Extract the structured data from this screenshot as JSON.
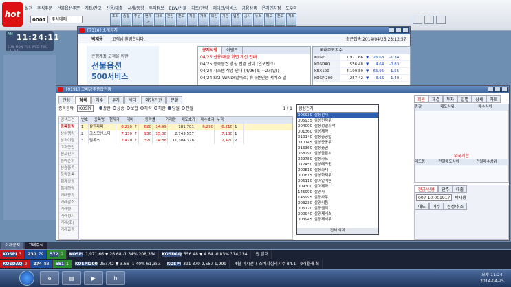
{
  "topbar": {
    "logo": "hot",
    "menu": [
      "실천",
      "주식주문",
      "선물옵션주문",
      "계좌/잔고",
      "신용/대출",
      "시세/동향",
      "투자정보",
      "ELW/선물",
      "차트/전략",
      "재테크/서비스",
      "금융상품",
      "온라인지점",
      "도우미"
    ],
    "account": "0001",
    "account_select": "주식매매",
    "toolbar": [
      "조회",
      "종합",
      "주문",
      "현재가",
      "차트",
      "관심",
      "잔고",
      "체결",
      "거래",
      "외인",
      "기관",
      "업종",
      "공시",
      "뉴스",
      "메모",
      "잔고",
      "계좌"
    ]
  },
  "clock": {
    "ampm": "AM",
    "time": "11:24:11",
    "days": "SUN MON TUE WED THU FRI SAT"
  },
  "win1": {
    "title": "[7310] 소개공지",
    "user": "박재용",
    "greeting": "고객님 환영합니다.",
    "last_login": "최근접속:2014/04/25 23:12:57",
    "ad": {
      "line1": "은행계좌 고객을 위한",
      "line2": "선물옵션",
      "line3": "500서비스"
    },
    "notice_tabs": [
      "공지사항",
      "이벤트"
    ],
    "notices": [
      "04/25 신용/대출 화면 개선 안내",
      "04/25 증목증권 명칭 변경 안내 (인포밴크)",
      "04/24 시스템 작업 안내 (4/26(토)~27(일))",
      "04/24 SKT WIND(말뚝조) 휴대폰인증 서비스 일"
    ],
    "index_title": "국내주요지수",
    "indices": [
      {
        "name": "KOSPI",
        "value": "1,971.66",
        "dir": "▼",
        "chg": "26.68",
        "pct": "-1.34"
      },
      {
        "name": "KOSDAQ",
        "value": "556.48",
        "dir": "▼",
        "chg": "4.64",
        "pct": "-0.83"
      },
      {
        "name": "KRX100",
        "value": "4,199.80",
        "dir": "▼",
        "chg": "65.95",
        "pct": "-1.55"
      },
      {
        "name": "KOSPI200",
        "value": "257.42",
        "dir": "▼",
        "chg": "3.66",
        "pct": "-1.40"
      }
    ]
  },
  "win2": {
    "title": "[0191] 고배당주종합현황",
    "tabs": [
      "관심",
      "검색",
      "지수",
      "투자",
      "섹터",
      "외인/기관",
      "분할"
    ],
    "filter": {
      "label": "종목등락",
      "market": "KOSPI",
      "opts": [
        "상한",
        "상승",
        "보합",
        "하락",
        "하한",
        "당일",
        "전일"
      ],
      "page": "1 / 1"
    },
    "conditions": [
      "검색조건",
      "종목등락",
      "상위랭킹",
      "상위이탈",
      "고저근접",
      "신고신저",
      "등락순위",
      "상승종목",
      "하락종목",
      "회계상승",
      "회계하락",
      "거래증가",
      "거래감소",
      "거래량",
      "거래정지",
      "거래(조)",
      "거래급등"
    ],
    "headers": [
      "번호",
      "종목명",
      "현재가",
      "대비",
      "등락률",
      "거래량",
      "매도호가",
      "매수호가",
      "누적"
    ],
    "rows": [
      {
        "no": "1",
        "name": "삼한파피",
        "price": "6,290",
        "dir": "↑",
        "chg": "820",
        "pct": "14.99",
        "vol": "181,701",
        "ask": "6,290",
        "bid": "6,210",
        "n": "1"
      },
      {
        "no": "2",
        "name": "코스모신소재",
        "price": "7,130",
        "dir": "↑",
        "chg": "930",
        "pct": "15.00",
        "vol": "2,743,557",
        "ask": "",
        "bid": "7,130",
        "n": "1"
      },
      {
        "no": "3",
        "name": "틸록스",
        "price": "2,470",
        "dir": "↑",
        "chg": "320",
        "pct": "14.88",
        "vol": "11,304,378",
        "ask": "",
        "bid": "2,470",
        "n": "2"
      }
    ],
    "dropdown": {
      "search": "삼성전자",
      "items": [
        [
          "005930",
          "삼성전자"
        ],
        [
          "005935",
          "삼성전자우"
        ],
        [
          "004000",
          "삼성정밀화학"
        ],
        [
          "001360",
          "삼성제약"
        ],
        [
          "010140",
          "삼성중공업"
        ],
        [
          "010145",
          "삼성중공우"
        ],
        [
          "016360",
          "삼성증권"
        ],
        [
          "068290",
          "삼성출판사"
        ],
        [
          "029780",
          "삼성카드"
        ],
        [
          "012450",
          "삼성테크윈"
        ],
        [
          "000810",
          "삼성화재"
        ],
        [
          "000815",
          "삼성화재우"
        ],
        [
          "006110",
          "삼아알미늄"
        ],
        [
          "009300",
          "삼아제약"
        ],
        [
          "145990",
          "삼양사"
        ],
        [
          "145995",
          "삼양사우"
        ],
        [
          "003230",
          "삼양식품"
        ],
        [
          "006720",
          "삼양엔텍"
        ],
        [
          "000940",
          "삼양제넥스"
        ],
        [
          "003945",
          "삼양제넥우"
        ]
      ],
      "footer": "전체 삭제"
    },
    "right": {
      "tabs": [
        "회원",
        "체결",
        "투자",
        "일별",
        "상세",
        "차트"
      ],
      "h1": "증감",
      "h2": "매도상위",
      "h3": "매수상위",
      "foreign": "외국계합",
      "f1": "매도동",
      "f2": "전일매도상위",
      "f3": "전일매수상위",
      "order_tabs": [
        "현금/신용",
        "단주",
        "대출"
      ],
      "acct": "007-10-001917",
      "acct_name": "박재용",
      "order_buttons": [
        "매도",
        "매수",
        "정정/취소"
      ]
    }
  },
  "bottom_tabs": [
    "소개공지",
    "고배주식"
  ],
  "ticker": {
    "row1": [
      [
        "KOSPI",
        "3"
      ],
      [
        "230",
        "79"
      ],
      [
        "572",
        "0"
      ],
      [
        "KOSPI",
        "1,971.66 ▼ 26.68 -1.34% 208,364"
      ],
      [
        "KOSDAQ",
        "556.48 ▼ 4.64 -0.83% 314,134"
      ],
      [
        "",
        "원 달러"
      ]
    ],
    "row2": [
      [
        "KOSDAQ",
        "2"
      ],
      [
        "274",
        "83"
      ],
      [
        "651",
        "1"
      ],
      [
        "KOSPI200",
        "257.42 ▼ 3.66 -1.40% 61,353"
      ],
      [
        "KOSPI",
        "391 379 2,557 1,999"
      ],
      [
        "",
        "4월 미시건대 소비자심리지수 84.1 - 9개월래 최"
      ]
    ]
  },
  "taskbar": {
    "time": "오후 11:24",
    "date": "2014-04-25"
  }
}
